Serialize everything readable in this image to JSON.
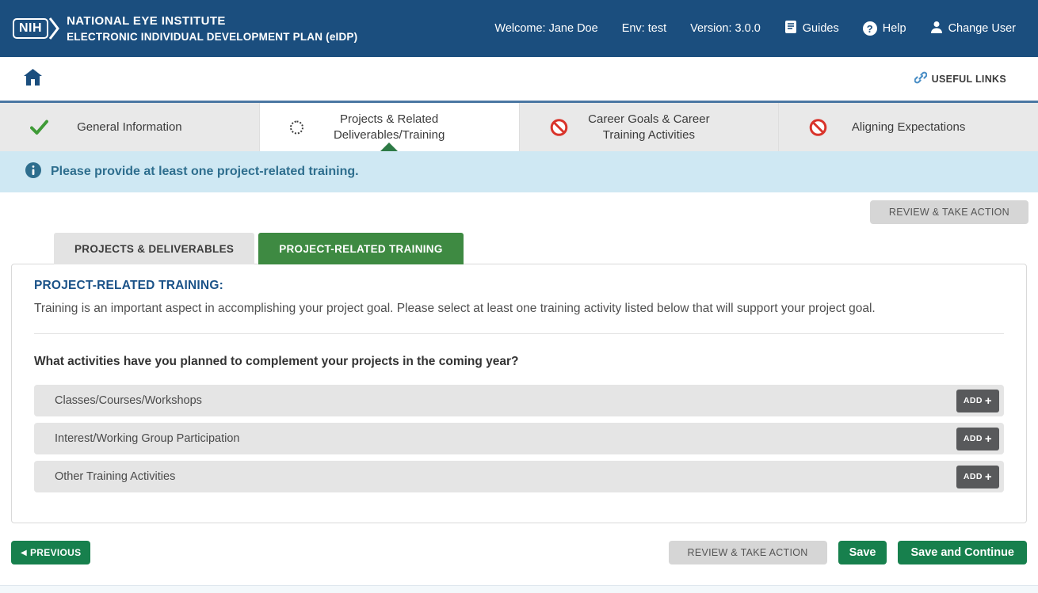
{
  "header": {
    "logo_text": "NIH",
    "org_name": "NATIONAL EYE INSTITUTE",
    "app_name": "ELECTRONIC INDIVIDUAL DEVELOPMENT PLAN (eIDP)",
    "welcome": "Welcome: Jane Doe",
    "env": "Env: test",
    "version": "Version: 3.0.0",
    "guides_label": "Guides",
    "help_label": "Help",
    "change_user_label": "Change User"
  },
  "toolbar": {
    "useful_links": "USEFUL LINKS"
  },
  "steps": [
    {
      "label": "General Information",
      "status": "complete"
    },
    {
      "label": "Projects & Related Deliverables/Training",
      "status": "in-progress"
    },
    {
      "label": "Career Goals & Career Training Activities",
      "status": "not-started"
    },
    {
      "label": "Aligning Expectations",
      "status": "not-started"
    }
  ],
  "alert": {
    "message": "Please provide at least one project-related training."
  },
  "actions": {
    "review": "REVIEW & TAKE ACTION",
    "previous": "PREVIOUS",
    "save": "Save",
    "save_continue": "Save and Continue"
  },
  "content_tabs": [
    {
      "label": "PROJECTS & DELIVERABLES",
      "active": false
    },
    {
      "label": "PROJECT-RELATED TRAINING",
      "active": true
    }
  ],
  "panel": {
    "heading": "PROJECT-RELATED TRAINING:",
    "description": "Training is an important aspect in accomplishing your project goal. Please select at least one training activity listed below that will support your project goal.",
    "question": "What activities have you planned to complement your projects in the coming year?",
    "rows": [
      {
        "label": "Classes/Courses/Workshops",
        "add": "ADD"
      },
      {
        "label": "Interest/Working Group Participation",
        "add": "ADD"
      },
      {
        "label": "Other Training Activities",
        "add": "ADD"
      }
    ]
  },
  "icons": {
    "previous_arrow": "◀",
    "add_plus": "+",
    "help_qmark": "?"
  },
  "colors": {
    "header_blue": "#1b4e7e",
    "toolbar_border_blue": "#4b77a3",
    "accent_green": "#17804d",
    "tab_green": "#3e8a42",
    "triangle_green": "#2d7a45",
    "check_green": "#3f9b37",
    "error_red": "#d9342b",
    "alert_bg": "#cfe8f3",
    "alert_text": "#2e6e8e",
    "heading_blue": "#1a5288",
    "link_blue": "#4b8fc6",
    "gray_button": "#d6d6d6",
    "add_button_gray": "#58595b"
  }
}
